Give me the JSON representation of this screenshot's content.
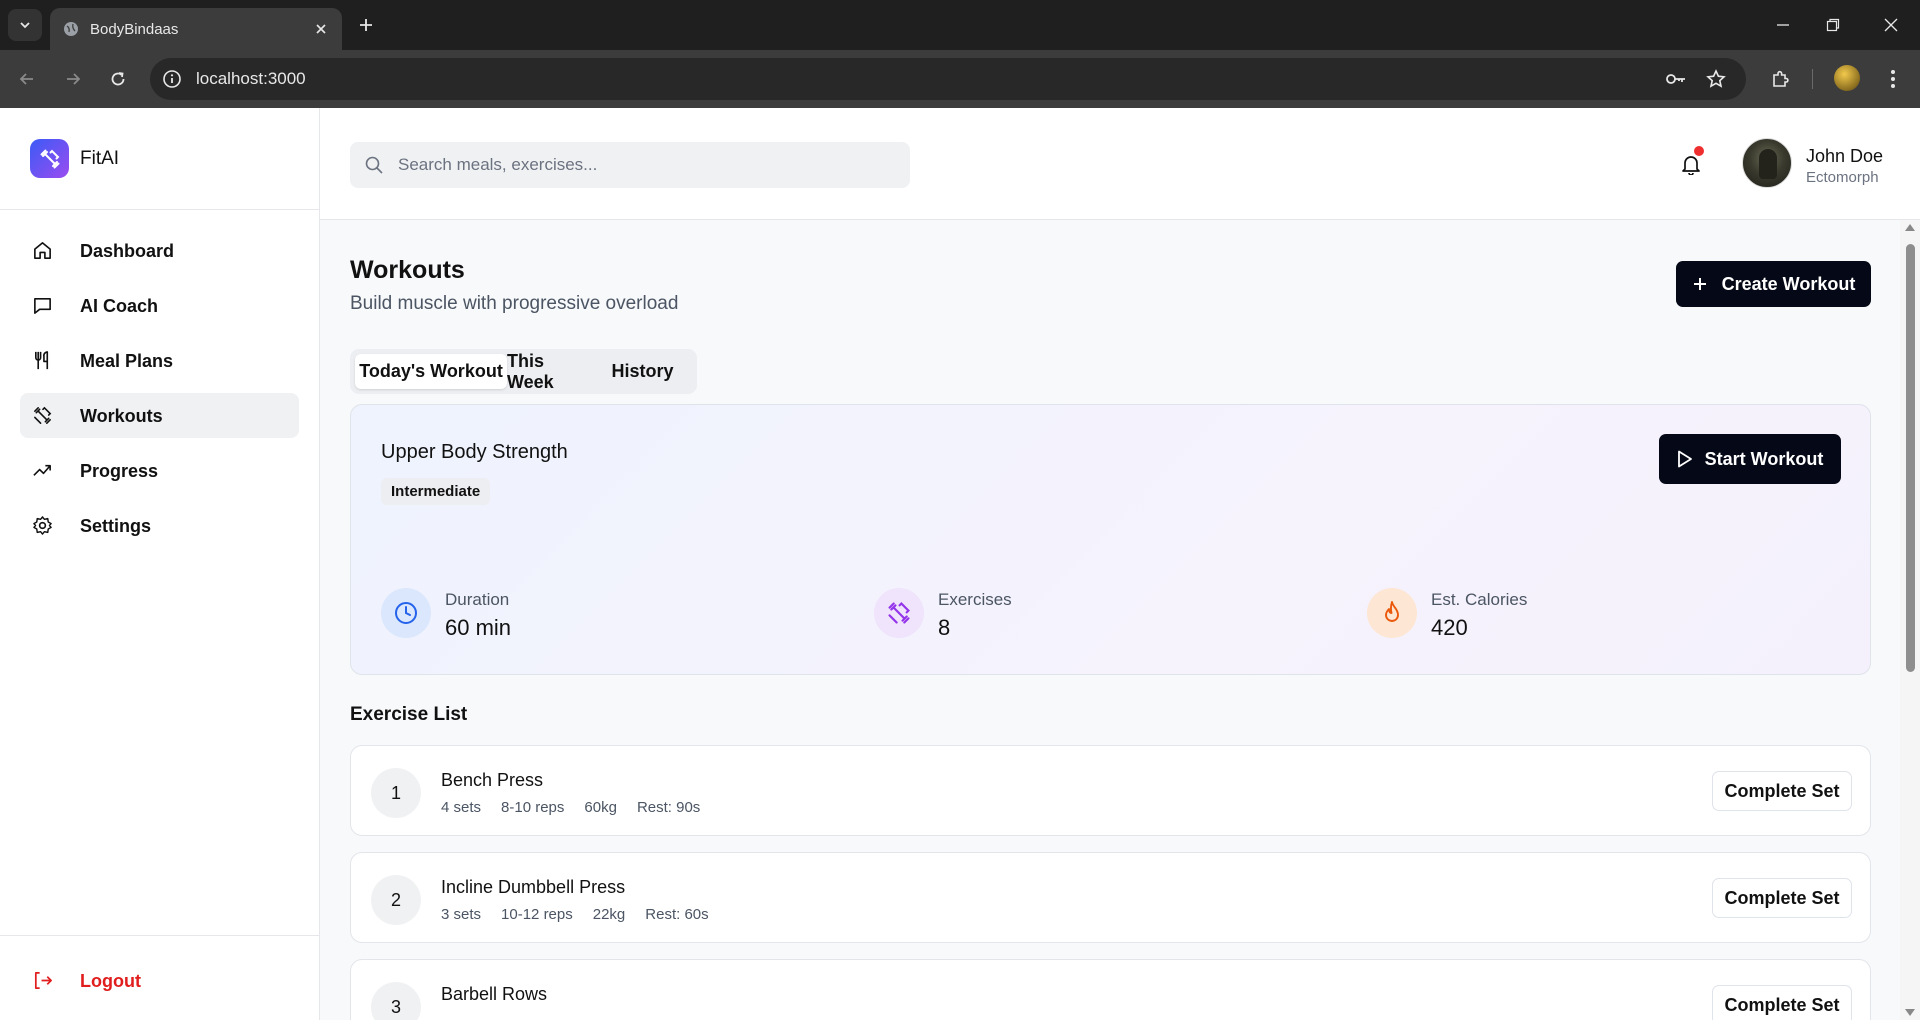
{
  "browser": {
    "tab_title": "BodyBindaas",
    "url": "localhost:3000"
  },
  "app": {
    "brand": "FitAI",
    "nav": [
      {
        "label": "Dashboard",
        "icon": "home-icon"
      },
      {
        "label": "AI Coach",
        "icon": "chat-icon"
      },
      {
        "label": "Meal Plans",
        "icon": "utensils-icon"
      },
      {
        "label": "Workouts",
        "icon": "dumbbell-icon",
        "active": true
      },
      {
        "label": "Progress",
        "icon": "trending-up-icon"
      },
      {
        "label": "Settings",
        "icon": "gear-icon"
      }
    ],
    "logout": "Logout"
  },
  "topbar": {
    "search_placeholder": "Search meals, exercises...",
    "user_name": "John Doe",
    "user_type": "Ectomorph"
  },
  "page": {
    "title": "Workouts",
    "subtitle": "Build muscle with progressive overload",
    "create_button": "Create Workout",
    "tabs": [
      "Today's Workout",
      "This Week",
      "History"
    ],
    "active_tab": "Today's Workout"
  },
  "workout": {
    "name": "Upper Body Strength",
    "level": "Intermediate",
    "start_button": "Start Workout",
    "stats": [
      {
        "label": "Duration",
        "value": "60 min",
        "icon": "clock-icon",
        "color": "#2563eb"
      },
      {
        "label": "Exercises",
        "value": "8",
        "icon": "dumbbell-icon",
        "color": "#9333ea"
      },
      {
        "label": "Est. Calories",
        "value": "420",
        "icon": "flame-icon",
        "color": "#ea580c"
      }
    ]
  },
  "exercise_list": {
    "title": "Exercise List",
    "button_label": "Complete Set",
    "items": [
      {
        "num": "1",
        "name": "Bench Press",
        "sets": "4 sets",
        "reps": "8-10 reps",
        "weight": "60kg",
        "rest": "Rest: 90s"
      },
      {
        "num": "2",
        "name": "Incline Dumbbell Press",
        "sets": "3 sets",
        "reps": "10-12 reps",
        "weight": "22kg",
        "rest": "Rest: 60s"
      },
      {
        "num": "3",
        "name": "Barbell Rows",
        "sets": "",
        "reps": "",
        "weight": "",
        "rest": ""
      }
    ]
  },
  "colors": {
    "primary_button": "#050816",
    "logout": "#e11d1d",
    "notification_dot": "#ef2f2f",
    "brand_gradient_start": "#3b5bf6",
    "brand_gradient_end": "#9b4cf0"
  }
}
